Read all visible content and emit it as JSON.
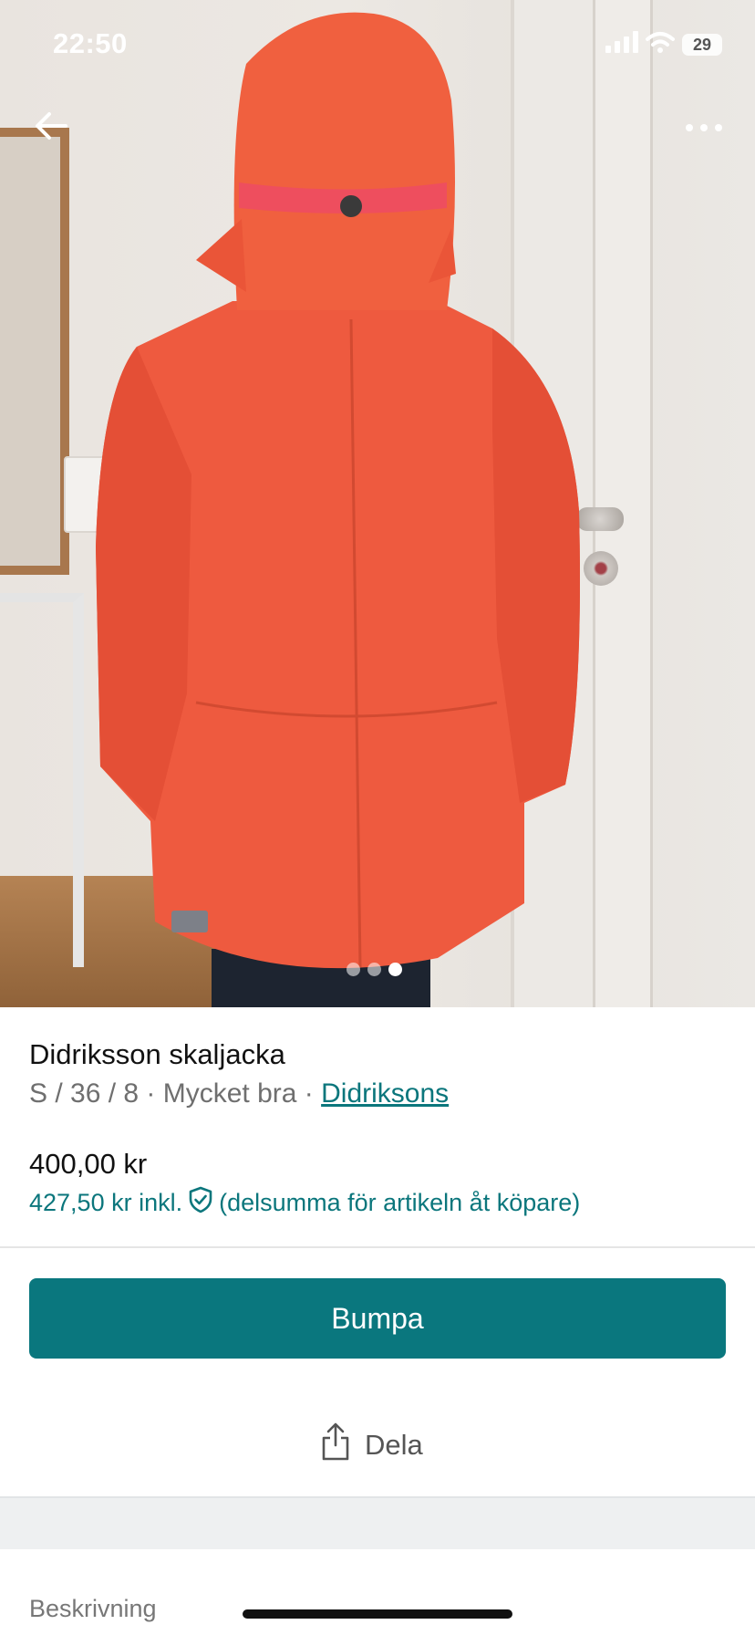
{
  "status_bar": {
    "time": "22:50",
    "battery": "29",
    "icons": [
      "cellular-signal-icon",
      "wifi-icon",
      "battery-icon"
    ]
  },
  "nav": {
    "back_icon": "arrow-left-icon",
    "more_icon": "more-horizontal-icon"
  },
  "gallery": {
    "image_count": 3,
    "active_index": 2
  },
  "item": {
    "title": "Didriksson skaljacka",
    "attributes": "S / 36 / 8 · Mycket bra · ",
    "brand": "Didriksons"
  },
  "pricing": {
    "price": "400,00 kr",
    "price_incl": "427,50 kr inkl.",
    "protection_icon": "shield-check-icon",
    "price_note": "(delsumma för artikeln åt köpare)"
  },
  "actions": {
    "bump_label": "Bumpa",
    "share_label": "Dela",
    "share_icon": "share-icon"
  },
  "sections": {
    "description_label": "Beskrivning"
  },
  "colors": {
    "accent": "#0a777e",
    "link": "#0b767c",
    "jacket": "#ef5a3e"
  }
}
